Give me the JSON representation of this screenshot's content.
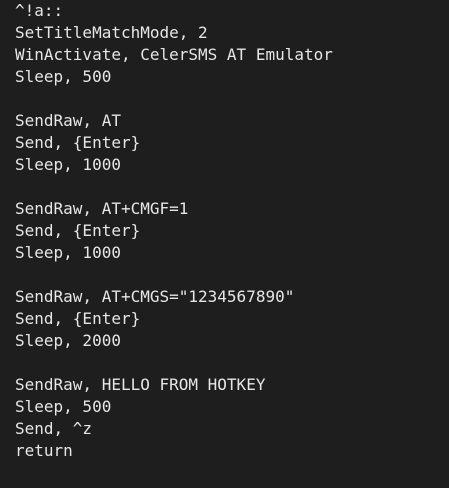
{
  "code": {
    "lines": [
      "^!a::",
      "SetTitleMatchMode, 2",
      "WinActivate, CelerSMS AT Emulator",
      "Sleep, 500",
      "",
      "SendRaw, AT",
      "Send, {Enter}",
      "Sleep, 1000",
      "",
      "SendRaw, AT+CMGF=1",
      "Send, {Enter}",
      "Sleep, 1000",
      "",
      "SendRaw, AT+CMGS=\"1234567890\"",
      "Send, {Enter}",
      "Sleep, 2000",
      "",
      "SendRaw, HELLO FROM HOTKEY",
      "Sleep, 500",
      "Send, ^z",
      "return"
    ]
  },
  "colors": {
    "background": "#1e1e1e",
    "text": "#e6e6e6"
  }
}
